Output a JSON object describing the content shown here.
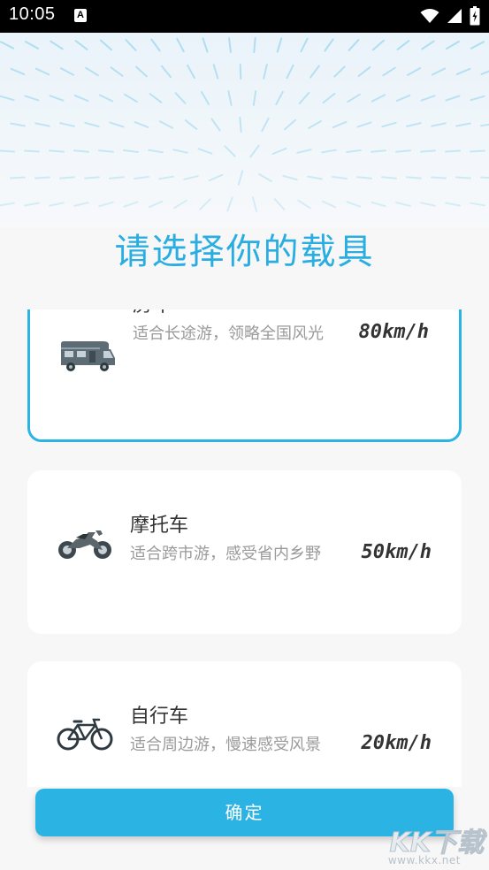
{
  "status_bar": {
    "time": "10:05",
    "notification_icon_label": "A",
    "icons": [
      "wifi-icon",
      "signal-icon",
      "battery-icon"
    ]
  },
  "page": {
    "title": "请选择你的载具"
  },
  "vehicles": [
    {
      "icon": "rv-icon",
      "name": "房车",
      "description": "适合长途游，领略全国风光",
      "speed": "80km/h",
      "selected": true
    },
    {
      "icon": "motorcycle-icon",
      "name": "摩托车",
      "description": "适合跨市游，感受省内乡野",
      "speed": "50km/h",
      "selected": false
    },
    {
      "icon": "bicycle-icon",
      "name": "自行车",
      "description": "适合周边游，慢速感受风景",
      "speed": "20km/h",
      "selected": false
    }
  ],
  "confirm_button": {
    "label": "确定"
  },
  "watermark": {
    "logo_text": "KK下载",
    "url": "www.kkx.net"
  },
  "colors": {
    "accent": "#2ab3e3",
    "title": "#2aaee2",
    "background": "#f7f7f8",
    "card": "#ffffff",
    "description": "#9a9a9a"
  }
}
